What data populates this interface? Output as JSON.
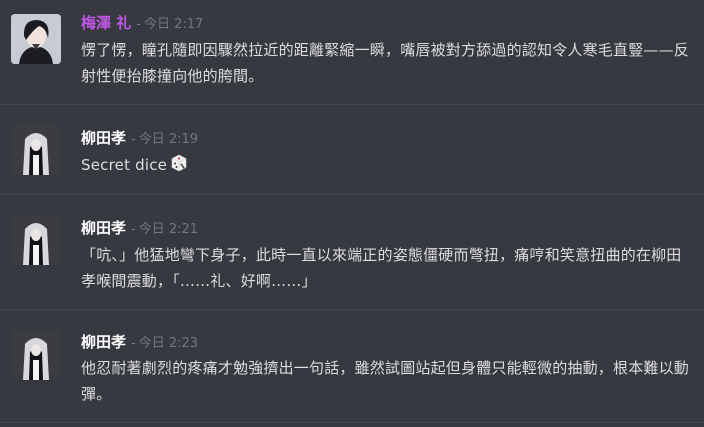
{
  "colors": {
    "background": "#36393f",
    "username_purple": "#c157e6",
    "username_default": "#ffffff",
    "text": "#dcddde",
    "muted": "#72767d"
  },
  "messages": [
    {
      "username": "梅澤 礼",
      "timestamp": "今日 2:17",
      "avatar_icon": "dark-haired-character-avatar",
      "text": "愣了愣，瞳孔隨即因驟然拉近的距離緊縮一瞬，嘴唇被對方舔過的認知令人寒毛直豎——反射性便抬膝撞向他的胯間。"
    },
    {
      "username": "柳田孝",
      "timestamp": "今日 2:19",
      "avatar_icon": "silver-haired-character-avatar",
      "text": "Secret dice",
      "emoji": "game-die-icon"
    },
    {
      "username": "柳田孝",
      "timestamp": "今日 2:21",
      "avatar_icon": "silver-haired-character-avatar",
      "text": "「吭、」他猛地彎下身子，此時一直以來端正的姿態僵硬而彆扭，痛哼和笑意扭曲的在柳田孝喉間震動，「……礼、好啊……」"
    },
    {
      "username": "柳田孝",
      "timestamp": "今日 2:23",
      "avatar_icon": "silver-haired-character-avatar",
      "text": "他忍耐著劇烈的疼痛才勉強擠出一句話，雖然試圖站起但身體只能輕微的抽動，根本難以動彈。"
    }
  ],
  "separator": "-"
}
